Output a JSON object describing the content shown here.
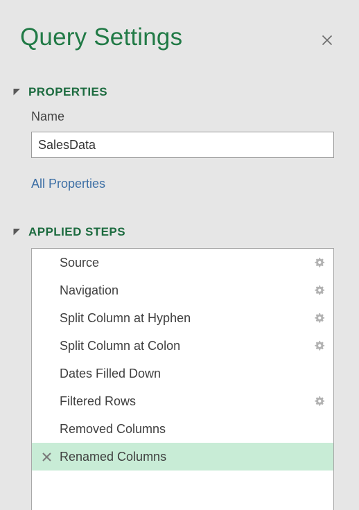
{
  "header": {
    "title": "Query Settings",
    "close_icon": "close-icon"
  },
  "properties": {
    "section_label": "PROPERTIES",
    "expanded_icon": "triangle-expanded-icon",
    "name_label": "Name",
    "name_value": "SalesData",
    "name_placeholder": "",
    "all_properties_link": "All Properties"
  },
  "applied_steps": {
    "section_label": "APPLIED STEPS",
    "expanded_icon": "triangle-expanded-icon",
    "steps": [
      {
        "label": "Source",
        "has_gear": true,
        "selected": false,
        "has_delete": false
      },
      {
        "label": "Navigation",
        "has_gear": true,
        "selected": false,
        "has_delete": false
      },
      {
        "label": "Split Column at Hyphen",
        "has_gear": true,
        "selected": false,
        "has_delete": false
      },
      {
        "label": "Split Column at Colon",
        "has_gear": true,
        "selected": false,
        "has_delete": false
      },
      {
        "label": "Dates Filled Down",
        "has_gear": false,
        "selected": false,
        "has_delete": false
      },
      {
        "label": "Filtered Rows",
        "has_gear": true,
        "selected": false,
        "has_delete": false
      },
      {
        "label": "Removed Columns",
        "has_gear": false,
        "selected": false,
        "has_delete": false
      },
      {
        "label": "Renamed Columns",
        "has_gear": false,
        "selected": true,
        "has_delete": true
      }
    ]
  },
  "colors": {
    "panel_background": "#e6e6e6",
    "title_green": "#217a46",
    "section_green": "#1c6b3f",
    "link_blue": "#3d6fa5",
    "selected_row_green": "#c8ecd6",
    "list_background": "#ffffff",
    "border_gray": "#a8a8a8",
    "gear_gray": "#b2b2b2",
    "text_gray": "#3f3f3f"
  }
}
